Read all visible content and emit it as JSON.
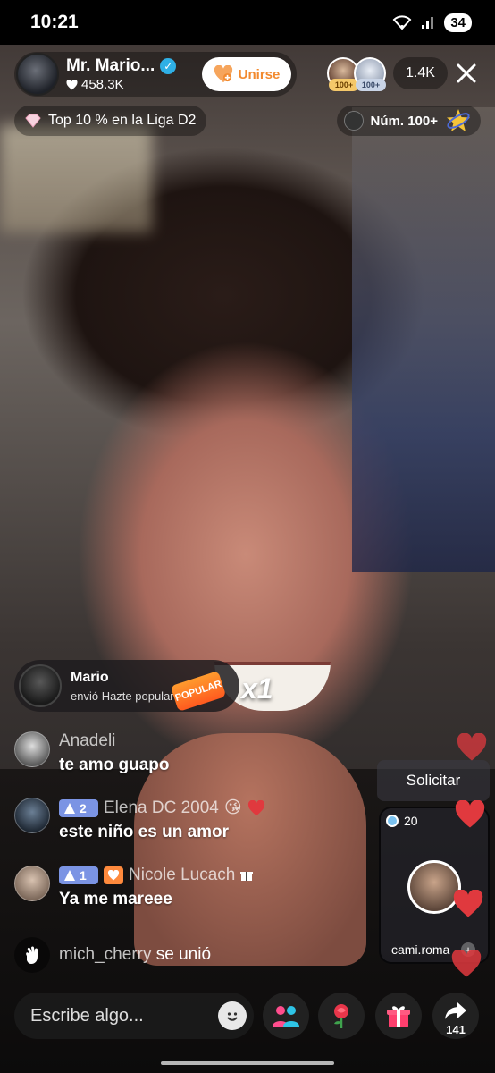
{
  "status_bar": {
    "time": "10:21",
    "battery": "34"
  },
  "host": {
    "name": "Mr. Mario...",
    "likes": "458.3K",
    "join_label": "Unirse"
  },
  "rank": {
    "label": "Top 10 % en la Liga D2"
  },
  "viewers": {
    "avatars": [
      {
        "badge": "100+"
      },
      {
        "badge": "100+"
      }
    ],
    "count": "1.4K"
  },
  "ranking_pill": {
    "label": "Núm. 100+"
  },
  "gift": {
    "user": "Mario",
    "desc": "envió Hazte popular",
    "sticker": "POPULAR",
    "count": "x1"
  },
  "comments": [
    {
      "user": "Anadeli",
      "text": "te amo guapo"
    },
    {
      "level": "2",
      "user": "Elena DC 2004",
      "text": "este niño es un amor"
    },
    {
      "level": "1",
      "user": "Nicole Lucach",
      "text": "Ya me mareee"
    }
  ],
  "join_notice": {
    "user": "mich_cherry",
    "action": "se unió"
  },
  "cohost": {
    "request_label": "Solicitar",
    "score": "20",
    "name": "cami.roma"
  },
  "bottom": {
    "input_placeholder": "Escribe algo...",
    "share_count": "141"
  },
  "colors": {
    "join_text": "#f28a2f",
    "verified": "#2fb0e6",
    "level_badge": "#7b94e4",
    "heart": "#e0393e"
  }
}
